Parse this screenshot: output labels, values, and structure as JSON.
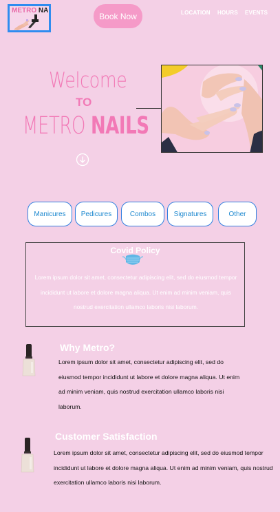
{
  "header": {
    "logo_part1": "METRO",
    "logo_part2": "NAILS",
    "book_label": "Book Now",
    "nav": [
      "LOCATION",
      "HOURS",
      "EVENTS"
    ]
  },
  "hero": {
    "welcome": "Welcome",
    "to": "TO",
    "brand_light": "METRO",
    "brand_bold": "NAILS"
  },
  "categories": [
    "Manicures",
    "Pedicures",
    "Combos",
    "Signatures",
    "Other"
  ],
  "covid": {
    "title": "Covid Policy",
    "body": "Lorem ipsum dolor sit amet, consectetur adipiscing elit, sed do eiusmod tempor incididunt ut labore et dolore magna aliqua. Ut enim ad minim veniam, quis nostrud exercitation ullamco laboris nisi laborum."
  },
  "why": {
    "title": "Why Metro?",
    "body": "Lorem ipsum dolor sit amet, consectetur adipiscing elit, sed do eiusmod tempor incididunt ut labore et dolore magna aliqua. Ut enim ad minim veniam, quis nostrud exercitation ullamco laboris nisi laborum."
  },
  "satisfaction": {
    "title": "Customer Satisfaction",
    "body": "Lorem ipsum dolor sit amet, consectetur adipiscing elit, sed do eiusmod tempor incididunt ut labore et dolore magna aliqua. Ut enim ad minim veniam, quis nostrud exercitation ullamco laboris nisi laborum."
  },
  "colors": {
    "background": "#f4d0e6",
    "accent_pink": "#f279b6",
    "button_pink": "#f59ac8",
    "category_text": "#1d88cf",
    "category_border": "#2f7fe0"
  },
  "icons": {
    "logo": "nail-polish-hand-icon",
    "scroll": "arrow-down-circle-icon",
    "covid": "face-mask-icon",
    "section": "nail-polish-bottle-icon"
  }
}
